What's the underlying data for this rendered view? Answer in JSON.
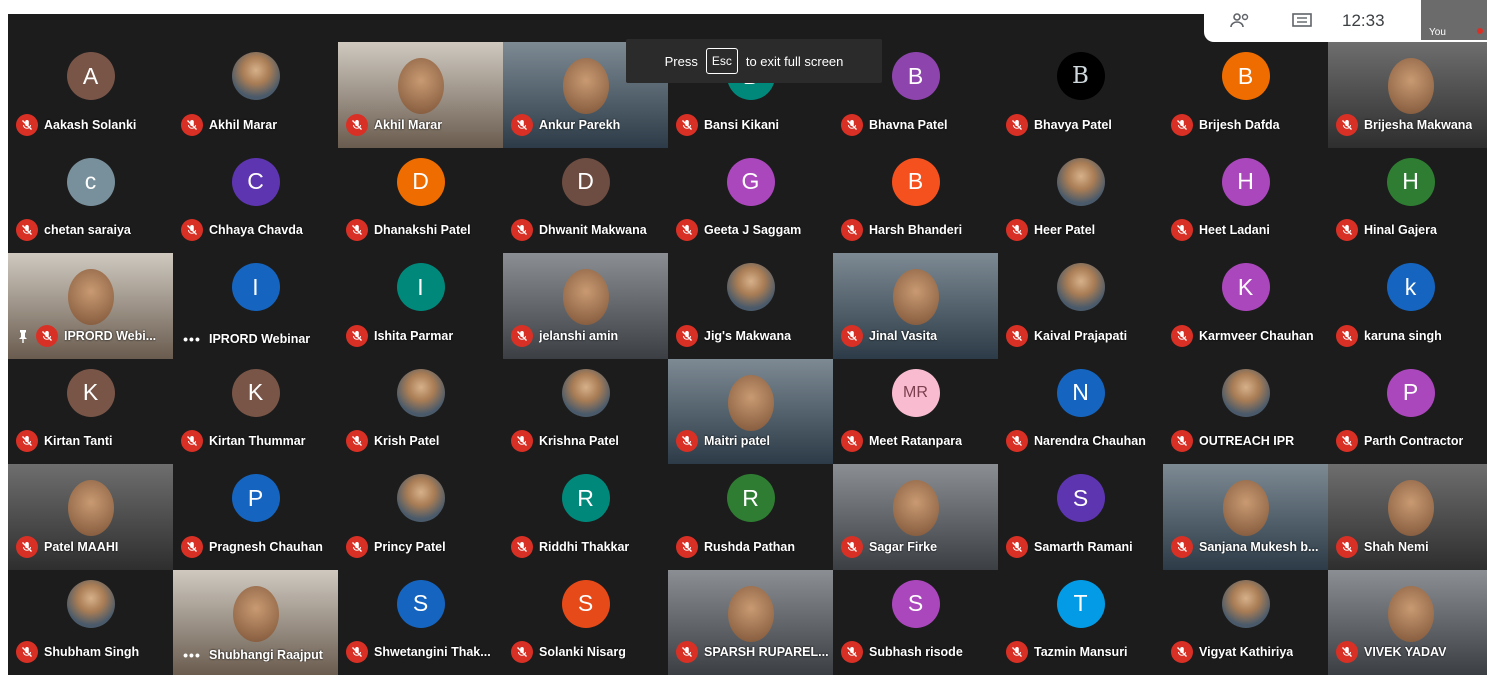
{
  "colors": {
    "muted": "#d93025",
    "background": "#1c1c1c"
  },
  "fullscreen_toast": {
    "press": "Press",
    "key": "Esc",
    "rest": "to exit full screen"
  },
  "topbar": {
    "clock": "12:33",
    "self_label": "You",
    "icons": [
      "people-icon",
      "chat-icon"
    ]
  },
  "participants": [
    {
      "name": "Aakash Solanki",
      "initial": "A",
      "color": "#795548",
      "kind": "avatar",
      "status": "muted"
    },
    {
      "name": "Akhil Marar",
      "initial": "",
      "color": "",
      "kind": "photo",
      "status": "muted"
    },
    {
      "name": "Akhil Marar",
      "initial": "",
      "color": "",
      "kind": "video",
      "status": "muted"
    },
    {
      "name": "Ankur Parekh",
      "initial": "",
      "color": "",
      "kind": "video",
      "status": "muted"
    },
    {
      "name": "Bansi Kikani",
      "initial": "B",
      "color": "#00897b",
      "kind": "avatar",
      "status": "muted"
    },
    {
      "name": "Bhavna Patel",
      "initial": "B",
      "color": "#8e44ad",
      "kind": "avatar",
      "status": "muted"
    },
    {
      "name": "Bhavya Patel",
      "initial": "B",
      "color": "#000000",
      "kind": "avatar",
      "status": "muted"
    },
    {
      "name": "Brijesh Dafda",
      "initial": "B",
      "color": "#ef6c00",
      "kind": "avatar",
      "status": "muted"
    },
    {
      "name": "Brijesha Makwana",
      "initial": "",
      "color": "",
      "kind": "video",
      "status": "muted"
    },
    {
      "name": "chetan saraiya",
      "initial": "c",
      "color": "#78909c",
      "kind": "avatar",
      "status": "muted"
    },
    {
      "name": "Chhaya Chavda",
      "initial": "C",
      "color": "#5e35b1",
      "kind": "avatar",
      "status": "muted"
    },
    {
      "name": "Dhanakshi Patel",
      "initial": "D",
      "color": "#ef6c00",
      "kind": "avatar",
      "status": "muted"
    },
    {
      "name": "Dhwanit Makwana",
      "initial": "D",
      "color": "#6d4c41",
      "kind": "avatar",
      "status": "muted"
    },
    {
      "name": "Geeta J Saggam",
      "initial": "G",
      "color": "#ab47bc",
      "kind": "avatar",
      "status": "muted"
    },
    {
      "name": "Harsh Bhanderi",
      "initial": "B",
      "color": "#f4511e",
      "kind": "avatar",
      "status": "muted"
    },
    {
      "name": "Heer Patel",
      "initial": "",
      "color": "",
      "kind": "photo",
      "status": "muted"
    },
    {
      "name": "Heet Ladani",
      "initial": "H",
      "color": "#ab47bc",
      "kind": "avatar",
      "status": "muted"
    },
    {
      "name": "Hinal Gajera",
      "initial": "H",
      "color": "#2e7d32",
      "kind": "avatar",
      "status": "muted"
    },
    {
      "name": "IPRORD Webi...",
      "initial": "",
      "color": "",
      "kind": "video",
      "status": "pinned-muted"
    },
    {
      "name": "IPRORD Webinar",
      "initial": "I",
      "color": "#1565c0",
      "kind": "avatar",
      "status": "more"
    },
    {
      "name": "Ishita Parmar",
      "initial": "I",
      "color": "#00897b",
      "kind": "avatar",
      "status": "muted"
    },
    {
      "name": "jelanshi amin",
      "initial": "",
      "color": "",
      "kind": "video",
      "status": "muted"
    },
    {
      "name": "Jig's Makwana",
      "initial": "",
      "color": "",
      "kind": "photo",
      "status": "muted"
    },
    {
      "name": "Jinal Vasita",
      "initial": "",
      "color": "",
      "kind": "video",
      "status": "muted"
    },
    {
      "name": "Kaival Prajapati",
      "initial": "",
      "color": "",
      "kind": "photo",
      "status": "muted"
    },
    {
      "name": "Karmveer Chauhan",
      "initial": "K",
      "color": "#ab47bc",
      "kind": "avatar",
      "status": "muted"
    },
    {
      "name": "karuna singh",
      "initial": "k",
      "color": "#1565c0",
      "kind": "avatar",
      "status": "muted"
    },
    {
      "name": "Kirtan Tanti",
      "initial": "K",
      "color": "#795548",
      "kind": "avatar",
      "status": "muted"
    },
    {
      "name": "Kirtan Thummar",
      "initial": "K",
      "color": "#795548",
      "kind": "avatar",
      "status": "muted"
    },
    {
      "name": "Krish Patel",
      "initial": "",
      "color": "",
      "kind": "photo",
      "status": "muted"
    },
    {
      "name": "Krishna Patel",
      "initial": "",
      "color": "",
      "kind": "photo",
      "status": "muted"
    },
    {
      "name": "Maitri patel",
      "initial": "",
      "color": "",
      "kind": "video",
      "status": "muted"
    },
    {
      "name": "Meet Ratanpara",
      "initial": "MR",
      "color": "#f8bbd0",
      "kind": "avatar",
      "status": "muted"
    },
    {
      "name": "Narendra Chauhan",
      "initial": "N",
      "color": "#1565c0",
      "kind": "avatar",
      "status": "muted"
    },
    {
      "name": "OUTREACH IPR",
      "initial": "",
      "color": "",
      "kind": "photo",
      "status": "muted"
    },
    {
      "name": "Parth Contractor",
      "initial": "P",
      "color": "#ab47bc",
      "kind": "avatar",
      "status": "muted"
    },
    {
      "name": "Patel MAAHI",
      "initial": "",
      "color": "",
      "kind": "video",
      "status": "muted"
    },
    {
      "name": "Pragnesh Chauhan",
      "initial": "P",
      "color": "#1565c0",
      "kind": "avatar",
      "status": "muted"
    },
    {
      "name": "Princy Patel",
      "initial": "",
      "color": "",
      "kind": "photo",
      "status": "muted"
    },
    {
      "name": "Riddhi Thakkar",
      "initial": "R",
      "color": "#00897b",
      "kind": "avatar",
      "status": "muted"
    },
    {
      "name": "Rushda Pathan",
      "initial": "R",
      "color": "#2e7d32",
      "kind": "avatar",
      "status": "muted"
    },
    {
      "name": "Sagar Firke",
      "initial": "",
      "color": "",
      "kind": "video",
      "status": "muted"
    },
    {
      "name": "Samarth Ramani",
      "initial": "S",
      "color": "#5e35b1",
      "kind": "avatar",
      "status": "muted"
    },
    {
      "name": "Sanjana Mukesh b...",
      "initial": "",
      "color": "",
      "kind": "video",
      "status": "muted"
    },
    {
      "name": "Shah Nemi",
      "initial": "",
      "color": "",
      "kind": "video",
      "status": "muted"
    },
    {
      "name": "Shubham Singh",
      "initial": "",
      "color": "",
      "kind": "photo",
      "status": "muted"
    },
    {
      "name": "Shubhangi Raajput",
      "initial": "",
      "color": "",
      "kind": "video",
      "status": "more"
    },
    {
      "name": "Shwetangini Thak...",
      "initial": "S",
      "color": "#1565c0",
      "kind": "avatar",
      "status": "muted"
    },
    {
      "name": "Solanki Nisarg",
      "initial": "S",
      "color": "#e64a19",
      "kind": "avatar",
      "status": "muted"
    },
    {
      "name": "SPARSH RUPAREL...",
      "initial": "",
      "color": "",
      "kind": "video",
      "status": "muted"
    },
    {
      "name": "Subhash risode",
      "initial": "S",
      "color": "#ab47bc",
      "kind": "avatar",
      "status": "muted"
    },
    {
      "name": "Tazmin Mansuri",
      "initial": "T",
      "color": "#039be5",
      "kind": "avatar",
      "status": "muted"
    },
    {
      "name": "Vigyat Kathiriya",
      "initial": "",
      "color": "",
      "kind": "photo",
      "status": "muted"
    },
    {
      "name": "VIVEK YADAV",
      "initial": "",
      "color": "",
      "kind": "video",
      "status": "muted"
    }
  ]
}
